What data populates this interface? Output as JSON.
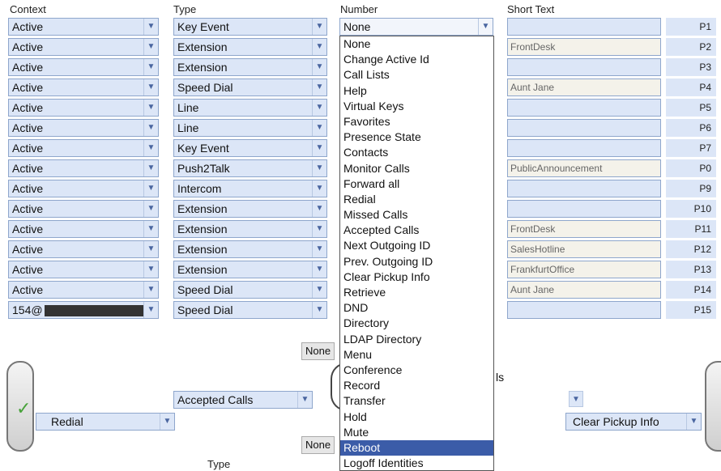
{
  "headers": {
    "context": "Context",
    "type": "Type",
    "number": "Number",
    "short_text": "Short Text"
  },
  "rows": [
    {
      "context": "Active",
      "type": "Key Event",
      "number": "None",
      "short": "",
      "p": "P1"
    },
    {
      "context": "Active",
      "type": "Extension",
      "short": "FrontDesk",
      "p": "P2"
    },
    {
      "context": "Active",
      "type": "Extension",
      "short": "",
      "p": "P3"
    },
    {
      "context": "Active",
      "type": "Speed Dial",
      "short": "Aunt Jane",
      "p": "P4"
    },
    {
      "context": "Active",
      "type": "Line",
      "short": "",
      "p": "P5"
    },
    {
      "context": "Active",
      "type": "Line",
      "short": "",
      "p": "P6"
    },
    {
      "context": "Active",
      "type": "Key Event",
      "short": "",
      "p": "P7"
    },
    {
      "context": "Active",
      "type": "Push2Talk",
      "short": "PublicAnnouncement",
      "p": "P0"
    },
    {
      "context": "Active",
      "type": "Intercom",
      "short": "",
      "p": "P9"
    },
    {
      "context": "Active",
      "type": "Extension",
      "short": "",
      "p": "P10"
    },
    {
      "context": "Active",
      "type": "Extension",
      "short": "FrontDesk",
      "p": "P11"
    },
    {
      "context": "Active",
      "type": "Extension",
      "short": "SalesHotline",
      "p": "P12"
    },
    {
      "context": "Active",
      "type": "Extension",
      "short": "FrankfurtOffice",
      "p": "P13"
    },
    {
      "context": "Active",
      "type": "Speed Dial",
      "short": "Aunt Jane",
      "p": "P14"
    },
    {
      "context": "154@",
      "type": "Speed Dial",
      "short": "",
      "p": "P15"
    }
  ],
  "dropdown": {
    "items": [
      "None",
      "Change Active Id",
      "Call Lists",
      "Help",
      "Virtual Keys",
      "Favorites",
      "Presence State",
      "Contacts",
      "Monitor Calls",
      "Forward all",
      "Redial",
      "Missed Calls",
      "Accepted Calls",
      "Next Outgoing ID",
      "Prev. Outgoing ID",
      "Clear Pickup Info",
      "Retrieve",
      "DND",
      "Directory",
      "LDAP Directory",
      "Menu",
      "Conference",
      "Record",
      "Transfer",
      "Hold",
      "Mute",
      "Reboot",
      "Logoff Identities"
    ],
    "selected": "Reboot"
  },
  "bottom": {
    "none1": "None",
    "none2": "None",
    "accepted_calls": "Accepted Calls",
    "redial": "Redial",
    "clear_pickup": "Clear Pickup Info",
    "fragment": "ls",
    "type_label": "Type"
  }
}
